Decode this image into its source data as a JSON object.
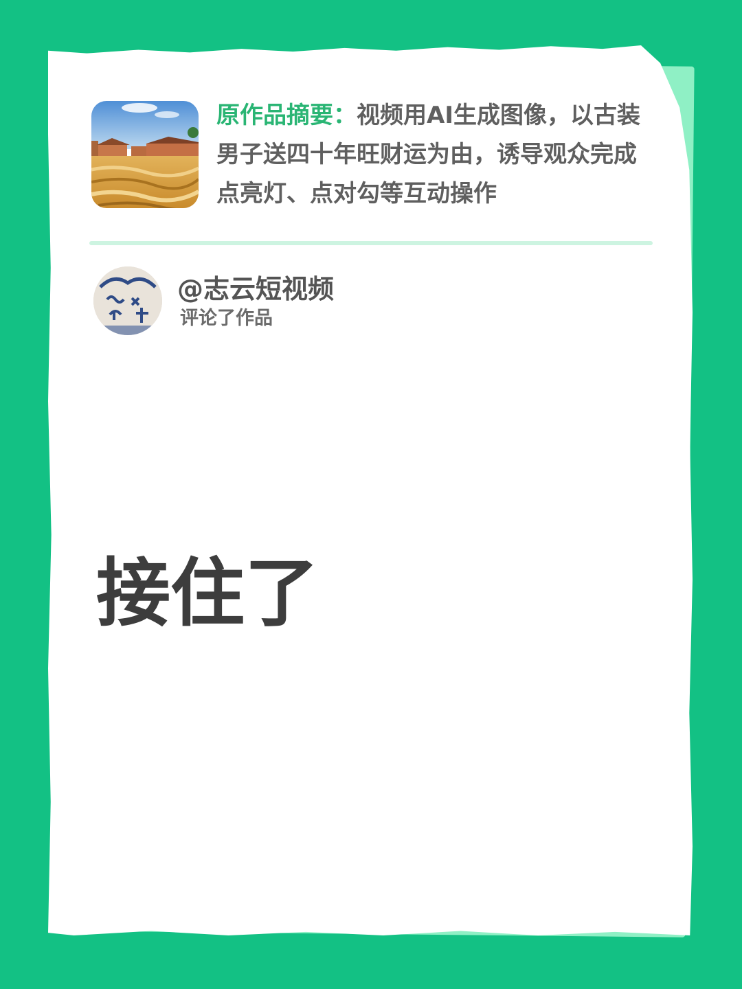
{
  "summary": {
    "label": "原作品摘要：",
    "text": "视频用AI生成图像，以古装男子送四十年旺财运为由，诱导观众完成点亮灯、点对勾等互动操作"
  },
  "commenter": {
    "username": "@志云短视频",
    "action": "评论了作品"
  },
  "comment": {
    "text": "接住了"
  },
  "colors": {
    "background": "#13c184",
    "accent": "#2ab574",
    "paper": "#ffffff"
  }
}
